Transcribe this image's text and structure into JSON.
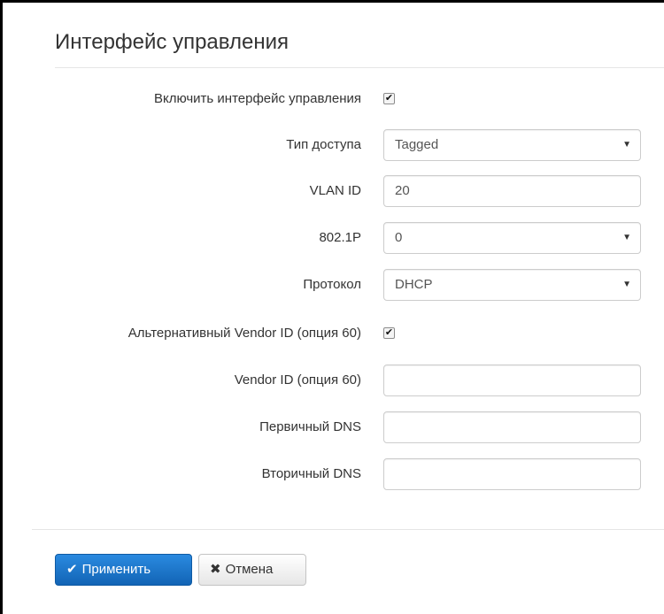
{
  "panel": {
    "title": "Интерфейс управления"
  },
  "form": {
    "enable_mgmt": {
      "label": "Включить интерфейс управления",
      "checked": true
    },
    "access_type": {
      "label": "Тип доступа",
      "value": "Tagged"
    },
    "vlan_id": {
      "label": "VLAN ID",
      "value": "20"
    },
    "p8021": {
      "label": "802.1P",
      "value": "0"
    },
    "protocol": {
      "label": "Протокол",
      "value": "DHCP"
    },
    "alt_vendor": {
      "label": "Альтернативный Vendor ID (опция 60)",
      "checked": true
    },
    "vendor_id": {
      "label": "Vendor ID (опция 60)",
      "value": ""
    },
    "dns1": {
      "label": "Первичный DNS",
      "value": ""
    },
    "dns2": {
      "label": "Вторичный DNS",
      "value": ""
    }
  },
  "buttons": {
    "apply": {
      "label": "Применить",
      "icon": "check-icon"
    },
    "cancel": {
      "label": "Отмена",
      "icon": "close-icon"
    }
  }
}
